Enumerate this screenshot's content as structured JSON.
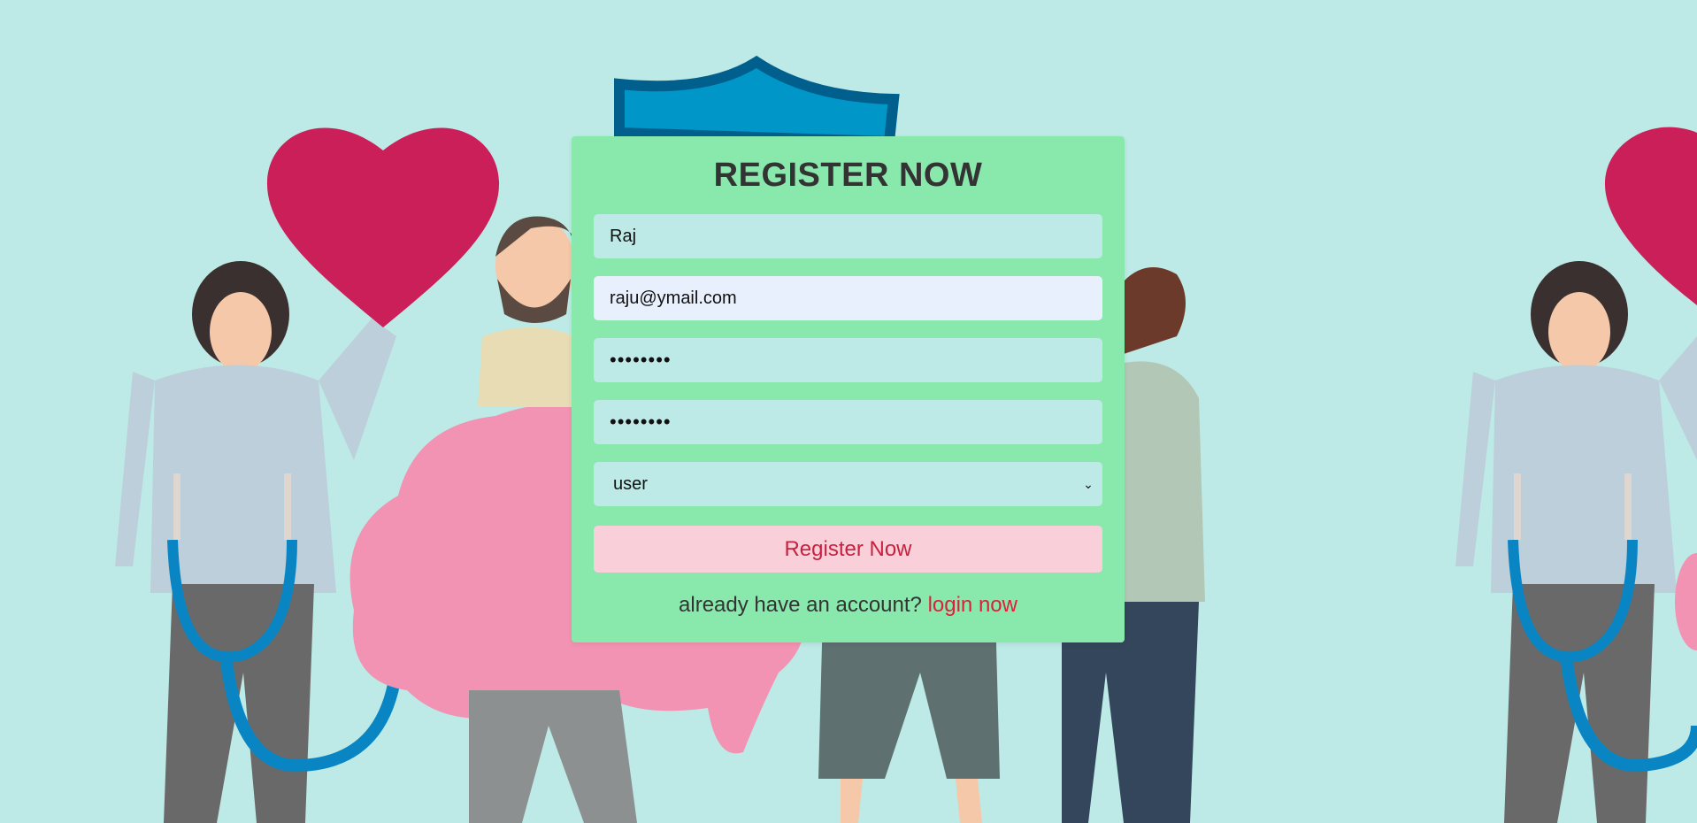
{
  "form": {
    "title": "REGISTER NOW",
    "name_value": "Raj",
    "email_value": "raju@ymail.com",
    "password_value": "••••••••",
    "confirm_password_value": "••••••••",
    "user_type_selected": "user",
    "submit_label": "Register Now",
    "footer_text": "already have an account?",
    "login_link_label": "login now"
  },
  "colors": {
    "background": "#bdeae6",
    "form_background": "#89e9ad",
    "button_background": "#f9d0da",
    "accent_red": "#d8213a"
  },
  "icons": [
    "chevron-down-icon"
  ]
}
